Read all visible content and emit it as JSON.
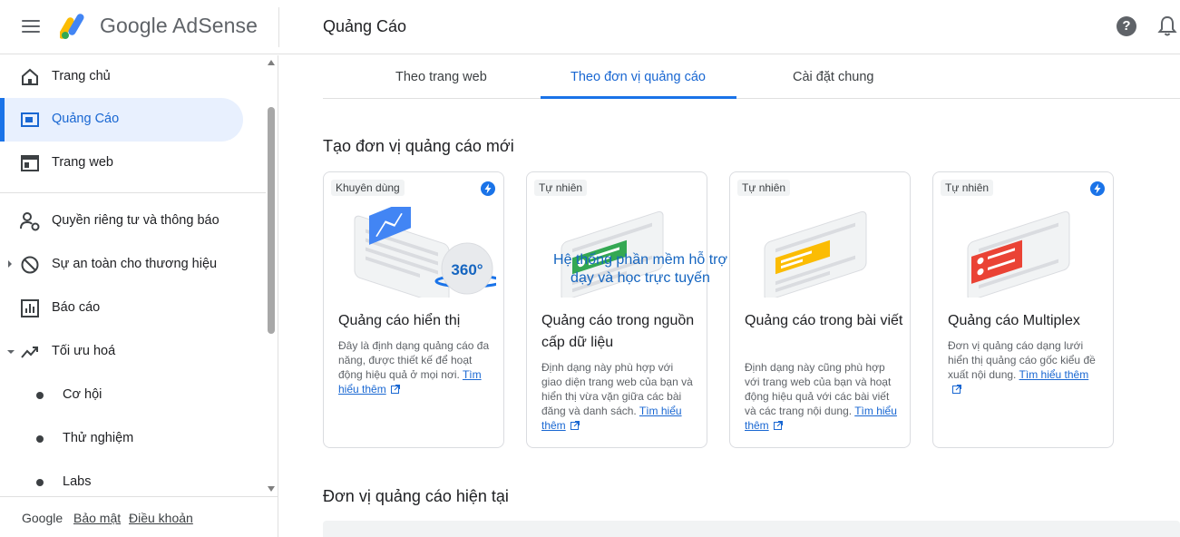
{
  "app": {
    "brand": "Google AdSense",
    "page_title": "Quảng Cáo"
  },
  "sidebar": {
    "items": [
      {
        "label": "Trang chủ",
        "icon": "home-icon"
      },
      {
        "label": "Quảng Cáo",
        "icon": "ads-icon",
        "active": true
      },
      {
        "label": "Trang web",
        "icon": "web-icon"
      },
      {
        "label": "Quyền riêng tư và thông báo",
        "icon": "privacy-icon"
      },
      {
        "label": "Sự an toàn cho thương hiệu",
        "icon": "block-icon",
        "expandable": true
      },
      {
        "label": "Báo cáo",
        "icon": "report-icon"
      },
      {
        "label": "Tối ưu hoá",
        "icon": "trending-icon",
        "expanded": true
      },
      {
        "label": "Cơ hội",
        "sub": true
      },
      {
        "label": "Thử nghiệm",
        "sub": true
      },
      {
        "label": "Labs",
        "sub": true
      }
    ],
    "footer": {
      "google": "Google",
      "privacy": "Bảo mật",
      "terms": "Điều khoản"
    }
  },
  "tabs": [
    {
      "label": "Theo trang web"
    },
    {
      "label": "Theo đơn vị quảng cáo",
      "active": true
    },
    {
      "label": "Cài đặt chung"
    }
  ],
  "section_new": "Tạo đơn vị quảng cáo mới",
  "section_current": "Đơn vị quảng cáo hiện tại",
  "cards": [
    {
      "badge": "Khuyên dùng",
      "title": "Quảng cáo hiển thị",
      "desc": "Đây là định dạng quảng cáo đa năng, được thiết kế để hoạt động hiệu quả ở mọi nơi.",
      "learn": "Tìm hiểu thêm",
      "bolt": true
    },
    {
      "badge": "Tự nhiên",
      "title": "Quảng cáo trong nguồn cấp dữ liệu",
      "desc": "Định dạng này phù hợp với giao diện trang web của bạn và hiển thị vừa vặn giữa các bài đăng và danh sách.",
      "learn": "Tìm hiểu thêm",
      "bolt": false
    },
    {
      "badge": "Tự nhiên",
      "title": "Quảng cáo trong bài viết",
      "desc": "Định dạng này cũng phù hợp với trang web của bạn và hoạt động hiệu quả với các bài viết và các trang nội dung.",
      "learn": "Tìm hiểu thêm",
      "bolt": false
    },
    {
      "badge": "Tự nhiên",
      "title": "Quảng cáo Multiplex",
      "desc": "Đơn vị quảng cáo dạng lưới hiển thị quảng cáo gốc kiểu đề xuất nội dung.",
      "learn": "Tìm hiểu thêm",
      "bolt": true
    }
  ],
  "overlay": {
    "badge_360": "360°",
    "watermark_line1": "Hệ thống phần mềm hỗ trợ",
    "watermark_line2": "dạy và học trực tuyến"
  },
  "colors": {
    "accent": "#1a73e8",
    "active_bg": "#e8f0fe",
    "display_ad": "#4285f4",
    "feed_ad": "#34a853",
    "article_ad": "#fbbc04",
    "multiplex_ad": "#ea4335"
  }
}
